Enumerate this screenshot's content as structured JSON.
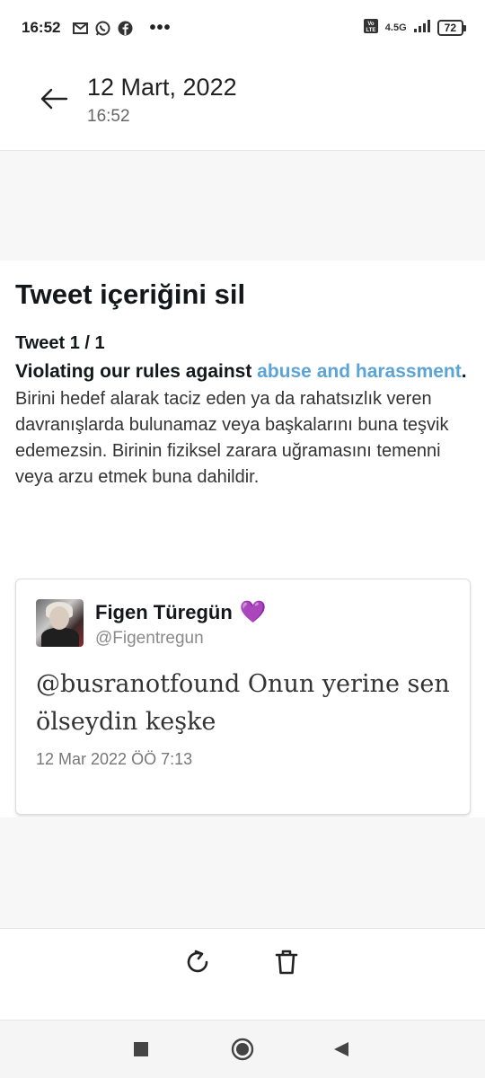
{
  "status_bar": {
    "time": "16:52",
    "notification_icons": [
      "gmail-icon",
      "whatsapp-icon",
      "facebook-icon"
    ],
    "more": "•••",
    "network": "4.5G",
    "battery": "72"
  },
  "header": {
    "title": "12 Mart, 2022",
    "subtitle": "16:52"
  },
  "content": {
    "title": "Tweet içeriğini sil",
    "tweet_count": "Tweet 1 / 1",
    "violation_prefix": "Violating our rules against ",
    "violation_link": "abuse and harassment",
    "violation_suffix": ".",
    "description": "Birini hedef alarak taciz eden ya da rahatsızlık veren davranışlarda bulunamaz veya başkalarını buna teşvik edemezsin. Birinin fiziksel zarara uğramasını temenni veya arzu etmek buna dahildir."
  },
  "tweet": {
    "author_name": "Figen Türegün",
    "author_emoji": "💜",
    "author_handle": "@Figentregun",
    "text": "@busranotfound Onun yerine sen ölseydin keşke",
    "date": "12 Mar 2022 ÖÖ 7:13"
  },
  "colors": {
    "link": "#5ba4d8",
    "heart": "#8e44ad"
  }
}
